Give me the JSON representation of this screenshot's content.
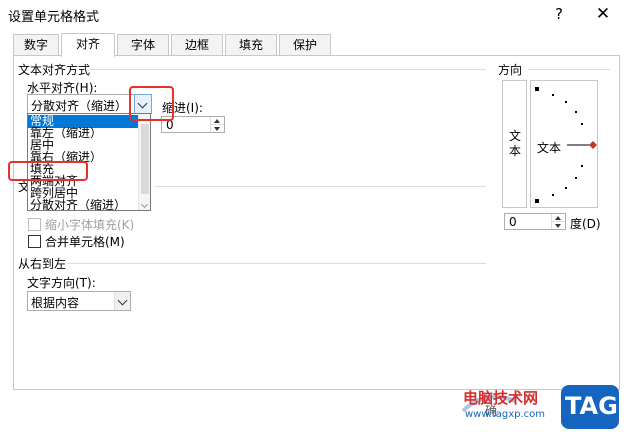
{
  "window": {
    "title": "设置单元格格式"
  },
  "tabs": [
    "数字",
    "对齐",
    "字体",
    "边框",
    "填充",
    "保护"
  ],
  "alignment": {
    "group_label": "文本对齐方式",
    "horizontal_label": "水平对齐(H):",
    "horizontal_value": "分散对齐（缩进）",
    "indent_label": "缩进(I):",
    "indent_value": "0",
    "dropdown_items": [
      "常规",
      "靠左（缩进）",
      "居中",
      "靠右（缩进）",
      "填充",
      "两端对齐",
      "跨列居中",
      "分散对齐（缩进）"
    ],
    "selected_item": "常规"
  },
  "text_control": {
    "group_label_visible": "文",
    "shrink_label": "缩小字体填充(K)",
    "merge_label": "合并单元格(M)"
  },
  "rtl": {
    "group_label": "从右到左",
    "direction_label": "文字方向(T):",
    "direction_value": "根据内容"
  },
  "orientation": {
    "group_label": "方向",
    "vertical_text": "文本",
    "text_label": "文本",
    "degree_value": "0",
    "degree_label": "度(D)"
  },
  "watermark": {
    "site_name": "电脑技术网",
    "site_url": "www.tagxp.com",
    "badge": "TAG",
    "bottom_text": "确"
  },
  "colors": {
    "selection": "#0078d7",
    "highlight": "#e8302a",
    "badge": "#1565c0"
  }
}
